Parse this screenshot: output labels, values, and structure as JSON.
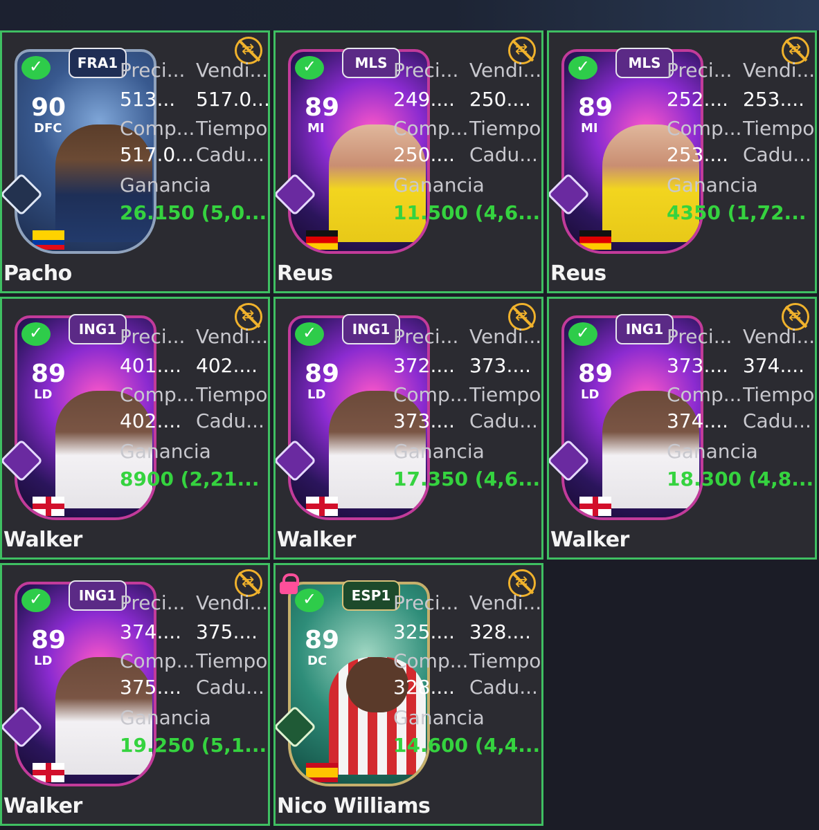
{
  "labels": {
    "precio": "Preci...",
    "vendido": "Vendi...",
    "compra": "Comp...",
    "tiempo": "Tiempo",
    "caducidad": "Cadu...",
    "ganancia": "Ganancia"
  },
  "tiles": [
    {
      "name": "Pacho",
      "league": "FRA1",
      "rating": "90",
      "position": "DFC",
      "price": "513...",
      "sold": "517.0...",
      "buy": "517.0...",
      "gain": "26.150 (5,0..."
    },
    {
      "name": "Reus",
      "league": "MLS",
      "rating": "89",
      "position": "MI",
      "price": "249....",
      "sold": "250....",
      "buy": "250....",
      "gain": "11.500 (4,6..."
    },
    {
      "name": "Reus",
      "league": "MLS",
      "rating": "89",
      "position": "MI",
      "price": "252....",
      "sold": "253....",
      "buy": "253....",
      "gain": "4350 (1,72..."
    },
    {
      "name": "Walker",
      "league": "ING1",
      "rating": "89",
      "position": "LD",
      "price": "401....",
      "sold": "402....",
      "buy": "402....",
      "gain": "8900 (2,21..."
    },
    {
      "name": "Walker",
      "league": "ING1",
      "rating": "89",
      "position": "LD",
      "price": "372....",
      "sold": "373....",
      "buy": "373....",
      "gain": "17.350 (4,6..."
    },
    {
      "name": "Walker",
      "league": "ING1",
      "rating": "89",
      "position": "LD",
      "price": "373....",
      "sold": "374....",
      "buy": "374....",
      "gain": "18.300 (4,8..."
    },
    {
      "name": "Walker",
      "league": "ING1",
      "rating": "89",
      "position": "LD",
      "price": "374....",
      "sold": "375....",
      "buy": "375....",
      "gain": "19.250 (5,1..."
    },
    {
      "name": "Nico Williams",
      "league": "ESP1",
      "rating": "89",
      "position": "DC",
      "price": "325....",
      "sold": "328....",
      "buy": "328....",
      "gain": "14.600 (4,4..."
    }
  ],
  "colors": {
    "border": "#3fbf62",
    "gain": "#35d33f",
    "tile_bg": "#2b2b31",
    "warning_icon": "#f0b22c"
  }
}
